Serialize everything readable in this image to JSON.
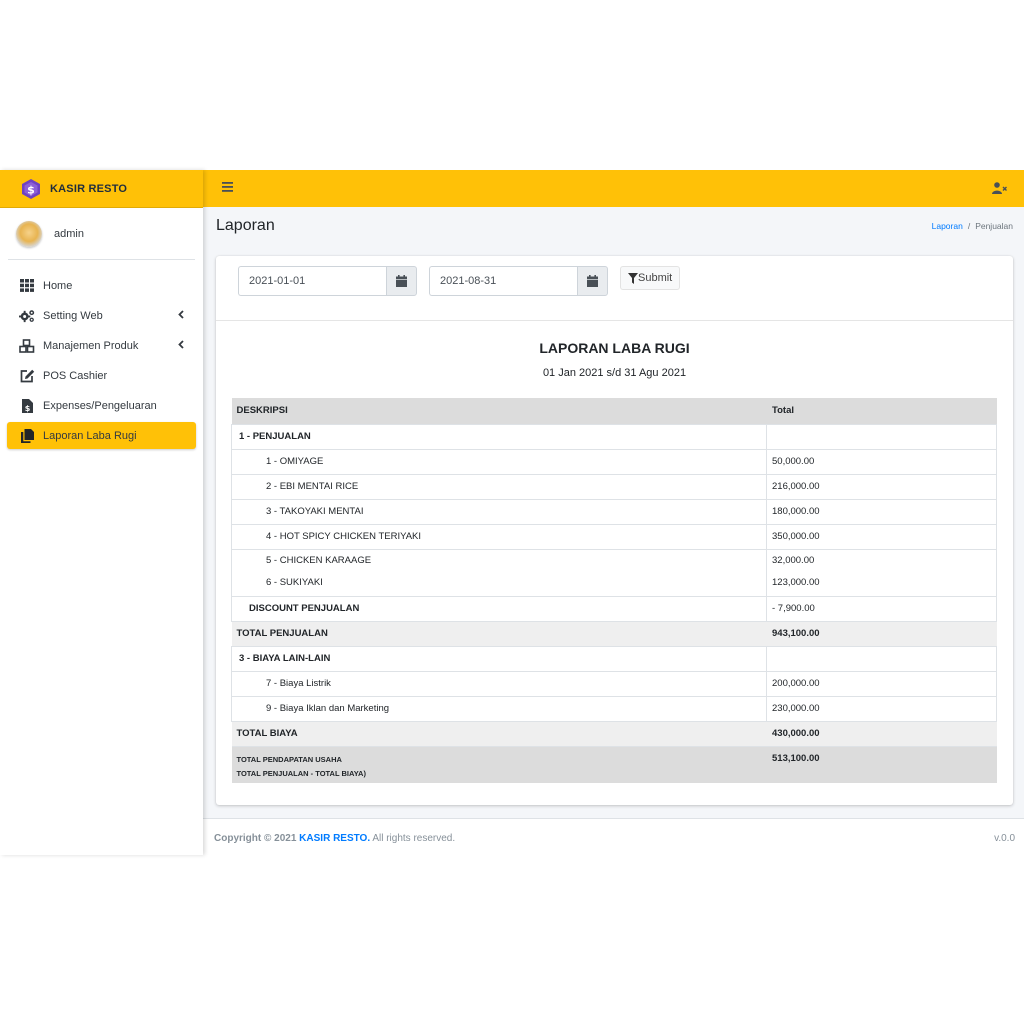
{
  "brand": {
    "name": "KASIR RESTO"
  },
  "user": {
    "name": "admin"
  },
  "sidebar": {
    "items": [
      {
        "label": "Home",
        "icon": "grid-icon"
      },
      {
        "label": "Setting Web",
        "icon": "gears-icon",
        "has_submenu": true
      },
      {
        "label": "Manajemen Produk",
        "icon": "cubes-icon",
        "has_submenu": true
      },
      {
        "label": "POS Cashier",
        "icon": "edit-icon"
      },
      {
        "label": "Expenses/Pengeluaran",
        "icon": "file-dollar-icon"
      },
      {
        "label": "Laporan Laba Rugi",
        "icon": "copy-icon",
        "active": true
      }
    ]
  },
  "header": {
    "page_title": "Laporan",
    "breadcrumb": {
      "link": "Laporan",
      "sep": "/",
      "current": "Penjualan"
    }
  },
  "filter": {
    "start_date": "2021-01-01",
    "end_date": "2021-08-31",
    "submit_label": "Submit"
  },
  "report": {
    "title": "LAPORAN LABA RUGI",
    "period": "01 Jan 2021 s/d 31 Agu 2021",
    "columns": {
      "desc": "DESKRIPSI",
      "total": "Total"
    },
    "sales_section": "1 - PENJUALAN",
    "sales_items": [
      {
        "desc": "1 - OMIYAGE",
        "total": "50,000.00"
      },
      {
        "desc": "2 - EBI MENTAI RICE",
        "total": "216,000.00"
      },
      {
        "desc": "3 - TAKOYAKI MENTAI",
        "total": "180,000.00"
      },
      {
        "desc": "4 - HOT SPICY CHICKEN TERIYAKI",
        "total": "350,000.00"
      },
      {
        "desc": "5 - CHICKEN KARAAGE",
        "total": "32,000.00"
      },
      {
        "desc": "6 - SUKIYAKI",
        "total": "123,000.00"
      }
    ],
    "discount": {
      "desc": "DISCOUNT PENJUALAN",
      "total": "- 7,900.00"
    },
    "total_sales": {
      "desc": "TOTAL PENJUALAN",
      "total": "943,100.00"
    },
    "expense_section": "3 - BIAYA LAIN-LAIN",
    "expense_items": [
      {
        "desc": "7 - Biaya Listrik",
        "total": "200,000.00"
      },
      {
        "desc": "9 - Biaya Iklan dan Marketing",
        "total": "230,000.00"
      }
    ],
    "total_cost": {
      "desc": "TOTAL BIAYA",
      "total": "430,000.00"
    },
    "grand": {
      "line1": "TOTAL PENDAPATAN USAHA",
      "line2": "TOTAL PENJUALAN - TOTAL BIAYA)",
      "total": "513,100.00"
    }
  },
  "footer": {
    "copyright_prefix": "Copyright © 2021 ",
    "brand": "KASIR RESTO.",
    "rights": " All rights reserved.",
    "version": "v.0.0"
  },
  "colors": {
    "accent": "#ffc107",
    "link": "#007bff",
    "logo": "#6f42c1"
  }
}
